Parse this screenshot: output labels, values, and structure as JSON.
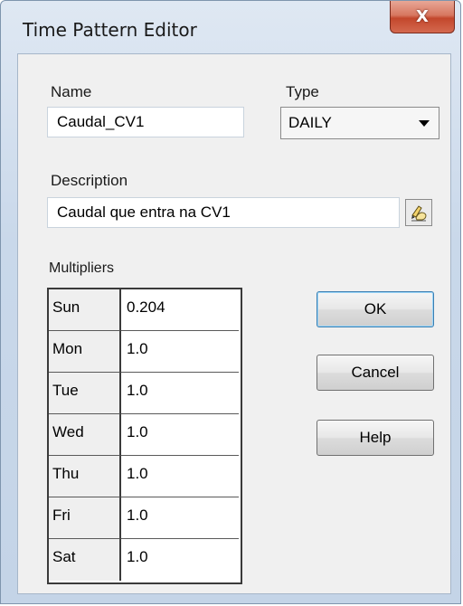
{
  "window": {
    "title": "Time Pattern Editor",
    "close_glyph": "X"
  },
  "form": {
    "name_label": "Name",
    "name_value": "Caudal_CV1",
    "type_label": "Type",
    "type_value": "DAILY",
    "description_label": "Description",
    "description_value": "Caudal que entra na CV1",
    "edit_icon": "hand-pencil-icon",
    "multipliers_label": "Multipliers"
  },
  "multipliers": [
    {
      "day": "Sun",
      "value": "0.204"
    },
    {
      "day": "Mon",
      "value": "1.0"
    },
    {
      "day": "Tue",
      "value": "1.0"
    },
    {
      "day": "Wed",
      "value": "1.0"
    },
    {
      "day": "Thu",
      "value": "1.0"
    },
    {
      "day": "Fri",
      "value": "1.0"
    },
    {
      "day": "Sat",
      "value": "1.0"
    }
  ],
  "buttons": {
    "ok": "OK",
    "cancel": "Cancel",
    "help": "Help"
  },
  "colors": {
    "close_button": "#c94a2e",
    "dialog_face": "#f0f0f0",
    "frame": "#c9d8ea"
  }
}
